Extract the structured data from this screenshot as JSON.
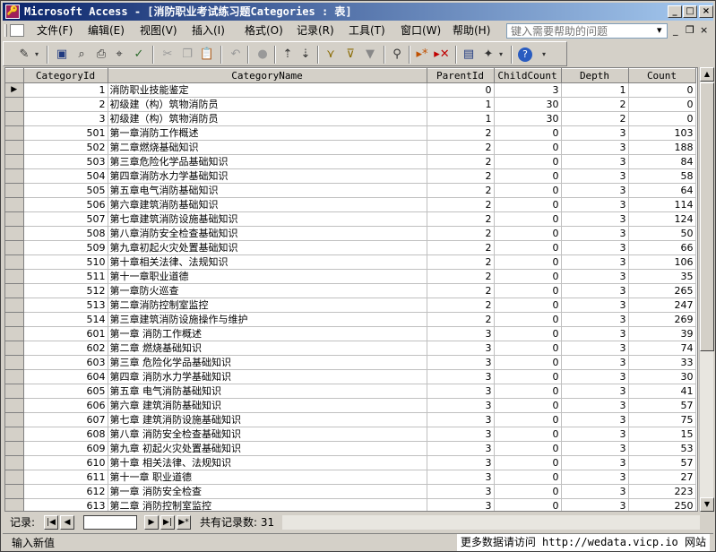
{
  "window": {
    "title": "Microsoft Access - [消防职业考试练习题Categories : 表]",
    "controls": [
      "_",
      "□",
      "×"
    ]
  },
  "menubar": {
    "items": [
      "文件(F)",
      "编辑(E)",
      "视图(V)",
      "插入(I)",
      "格式(O)",
      "记录(R)",
      "工具(T)",
      "窗口(W)",
      "帮助(H)"
    ],
    "help_placeholder": "键入需要帮助的问题",
    "mdi_controls": [
      "▾",
      "_",
      "❐",
      "×"
    ]
  },
  "grid": {
    "columns": [
      "CategoryId",
      "CategoryName",
      "ParentId",
      "ChildCount",
      "Depth",
      "Count"
    ],
    "rows": [
      [
        1,
        "消防职业技能鉴定",
        0,
        3,
        1,
        0
      ],
      [
        2,
        "初级建（构）筑物消防员",
        1,
        30,
        2,
        0
      ],
      [
        3,
        "初级建（构）筑物消防员",
        1,
        30,
        2,
        0
      ],
      [
        501,
        "第一章消防工作概述",
        2,
        0,
        3,
        103
      ],
      [
        502,
        "第二章燃烧基础知识",
        2,
        0,
        3,
        188
      ],
      [
        503,
        "第三章危险化学品基础知识",
        2,
        0,
        3,
        84
      ],
      [
        504,
        "第四章消防水力学基础知识",
        2,
        0,
        3,
        58
      ],
      [
        505,
        "第五章电气消防基础知识",
        2,
        0,
        3,
        64
      ],
      [
        506,
        "第六章建筑消防基础知识",
        2,
        0,
        3,
        114
      ],
      [
        507,
        "第七章建筑消防设施基础知识",
        2,
        0,
        3,
        124
      ],
      [
        508,
        "第八章消防安全检查基础知识",
        2,
        0,
        3,
        50
      ],
      [
        509,
        "第九章初起火灾处置基础知识",
        2,
        0,
        3,
        66
      ],
      [
        510,
        "第十章相关法律、法规知识",
        2,
        0,
        3,
        106
      ],
      [
        511,
        "第十一章职业道德",
        2,
        0,
        3,
        35
      ],
      [
        512,
        "第一章防火巡查",
        2,
        0,
        3,
        265
      ],
      [
        513,
        "第二章消防控制室监控",
        2,
        0,
        3,
        247
      ],
      [
        514,
        "第三章建筑消防设施操作与维护",
        2,
        0,
        3,
        269
      ],
      [
        601,
        "第一章 消防工作概述",
        3,
        0,
        3,
        39
      ],
      [
        602,
        "第二章 燃烧基础知识",
        3,
        0,
        3,
        74
      ],
      [
        603,
        "第三章 危险化学品基础知识",
        3,
        0,
        3,
        33
      ],
      [
        604,
        "第四章 消防水力学基础知识",
        3,
        0,
        3,
        30
      ],
      [
        605,
        "第五章 电气消防基础知识",
        3,
        0,
        3,
        41
      ],
      [
        606,
        "第六章 建筑消防基础知识",
        3,
        0,
        3,
        57
      ],
      [
        607,
        "第七章 建筑消防设施基础知识",
        3,
        0,
        3,
        75
      ],
      [
        608,
        "第八章 消防安全检查基础知识",
        3,
        0,
        3,
        15
      ],
      [
        609,
        "第九章 初起火灾处置基础知识",
        3,
        0,
        3,
        53
      ],
      [
        610,
        "第十章 相关法律、法规知识",
        3,
        0,
        3,
        57
      ],
      [
        611,
        "第十一章 职业道德",
        3,
        0,
        3,
        27
      ],
      [
        612,
        "第一章 消防安全检查",
        3,
        0,
        3,
        223
      ],
      [
        613,
        "第二章 消防控制室监控",
        3,
        0,
        3,
        250
      ]
    ]
  },
  "navbar": {
    "record_label": "记录:",
    "record_value": "",
    "total_label": "共有记录数: 31"
  },
  "status": {
    "text": "输入新值",
    "watermark": "更多数据请访问 http://wedata.vicp.io 网站"
  }
}
